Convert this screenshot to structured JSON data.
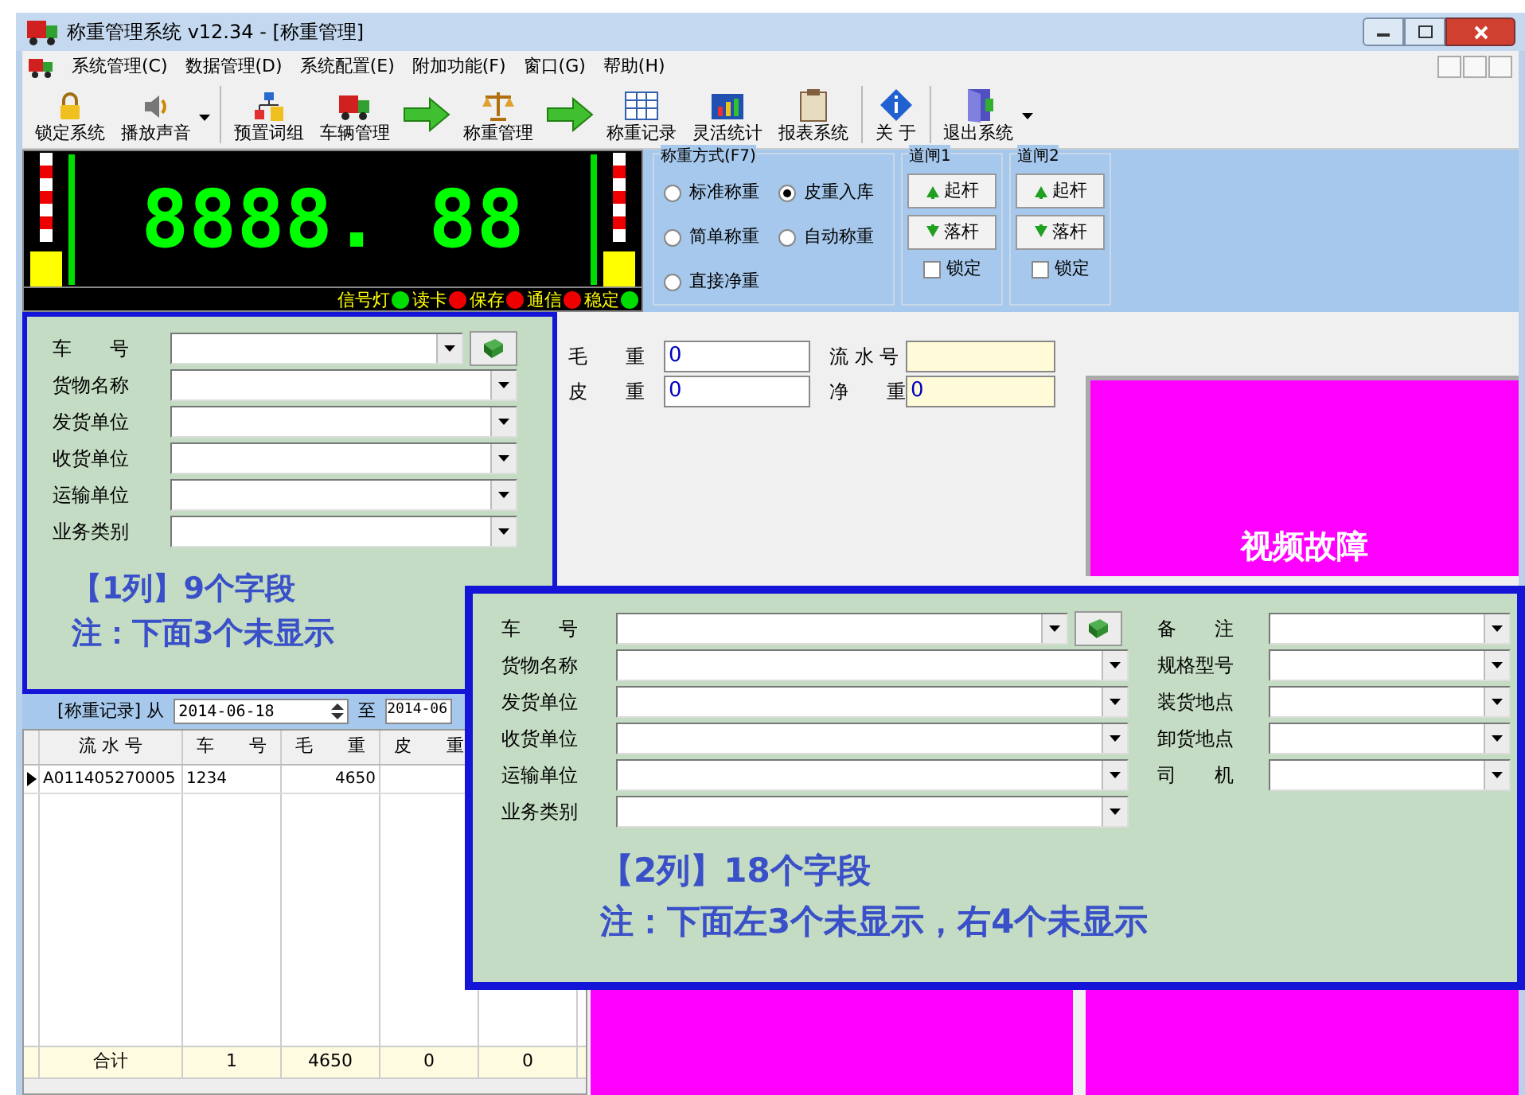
{
  "window": {
    "title": "称重管理系统 v12.34 - [称重管理]"
  },
  "menu": [
    "系统管理(C)",
    "数据管理(D)",
    "系统配置(E)",
    "附加功能(F)",
    "窗口(G)",
    "帮助(H)"
  ],
  "toolbar": [
    {
      "kind": "lock",
      "label": "锁定系统"
    },
    {
      "kind": "speaker",
      "label": "播放声音",
      "dropdown": true
    },
    {
      "kind": "separator"
    },
    {
      "kind": "group",
      "label": "预置词组"
    },
    {
      "kind": "truck",
      "label": "车辆管理"
    },
    {
      "kind": "arrow"
    },
    {
      "kind": "scale",
      "label": "称重管理"
    },
    {
      "kind": "arrow"
    },
    {
      "kind": "grid",
      "label": "称重记录"
    },
    {
      "kind": "chart",
      "label": "灵活统计"
    },
    {
      "kind": "clipboard",
      "label": "报表系统"
    },
    {
      "kind": "separator"
    },
    {
      "kind": "info",
      "label": "关 于"
    },
    {
      "kind": "separator"
    },
    {
      "kind": "exit",
      "label": "退出系统",
      "dropdown": true
    }
  ],
  "display": {
    "reading": "8888. 88",
    "indicators": [
      {
        "label": "信号灯",
        "color": "#00dd00"
      },
      {
        "label": "读卡",
        "color": "#ee0000"
      },
      {
        "label": "保存",
        "color": "#ee0000"
      },
      {
        "label": "通信",
        "color": "#ee0000"
      },
      {
        "label": "稳定",
        "color": "#00dd00"
      }
    ]
  },
  "weigh_mode": {
    "title": "称重方式(F7)",
    "options": [
      {
        "label": "标准称重",
        "selected": false
      },
      {
        "label": "皮重入库",
        "selected": true
      },
      {
        "label": "简单称重",
        "selected": false
      },
      {
        "label": "自动称重",
        "selected": false
      },
      {
        "label": "直接净重",
        "selected": false
      }
    ]
  },
  "gates": [
    {
      "title": "道闸1",
      "raise": "起杆",
      "lower": "落杆",
      "lock": {
        "label": "锁定",
        "checked": false
      }
    },
    {
      "title": "道闸2",
      "raise": "起杆",
      "lower": "落杆",
      "lock": {
        "label": "锁定",
        "checked": false
      }
    }
  ],
  "form1": {
    "fields": [
      {
        "label": "车　　号",
        "kind": "combo_book"
      },
      {
        "label": "货物名称",
        "kind": "combo"
      },
      {
        "label": "发货单位",
        "kind": "combo"
      },
      {
        "label": "收货单位",
        "kind": "combo"
      },
      {
        "label": "运输单位",
        "kind": "combo"
      },
      {
        "label": "业务类别",
        "kind": "combo"
      }
    ],
    "note": [
      "【1列】9个字段",
      "注：下面3个未显示"
    ]
  },
  "weights": [
    {
      "label": "毛　　重",
      "value": "0",
      "readonly": false
    },
    {
      "label": "流 水 号",
      "readonly": true
    },
    {
      "label": "皮　　重",
      "value": "0",
      "readonly": false
    },
    {
      "label": "净　　重",
      "value": "0",
      "readonly": true
    }
  ],
  "video": {
    "message": "视频故障"
  },
  "form2": {
    "left": [
      {
        "label": "车　　号",
        "kind": "combo_book"
      },
      {
        "label": "货物名称",
        "kind": "combo"
      },
      {
        "label": "发货单位",
        "kind": "combo"
      },
      {
        "label": "收货单位",
        "kind": "combo"
      },
      {
        "label": "运输单位",
        "kind": "combo"
      },
      {
        "label": "业务类别",
        "kind": "combo"
      }
    ],
    "right": [
      {
        "label": "备　　注",
        "kind": "combo"
      },
      {
        "label": "规格型号",
        "kind": "combo"
      },
      {
        "label": "装货地点",
        "kind": "combo"
      },
      {
        "label": "卸货地点",
        "kind": "combo"
      },
      {
        "label": "司　　机",
        "kind": "combo"
      }
    ],
    "note": [
      "【2列】18个字段",
      "注：下面左3个未显示，右4个未显示"
    ]
  },
  "records": {
    "label": "[称重记录] 从",
    "from": "2014-06-18",
    "to_label": "至",
    "to": "2014-06"
  },
  "table": {
    "columns": [
      "流 水 号",
      "车　　号",
      "毛　　重",
      "皮　　重"
    ],
    "rows": [
      {
        "cells": [
          "A011405270005",
          "1234",
          "4650"
        ],
        "selected": true
      }
    ],
    "totals": [
      "合计",
      "1",
      "4650",
      "0",
      "0"
    ]
  }
}
